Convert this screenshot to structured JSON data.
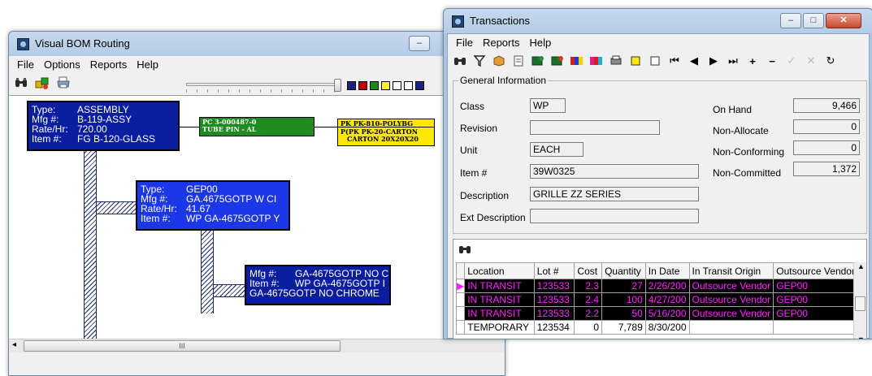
{
  "bom": {
    "title": "Visual BOM Routing",
    "menu": [
      "File",
      "Options",
      "Reports",
      "Help"
    ],
    "caption_min": "–",
    "toolbar_icons": [
      "binoculars-icon",
      "puzzle-icon",
      "printer-icon"
    ],
    "swatch_colors": [
      "#1a237e",
      "#c00000",
      "#1b8a1b",
      "#ffef33",
      "#ffffff",
      "#ffffff",
      "#1a237e"
    ],
    "nodes": {
      "assembly": {
        "color": "#0b1ea0",
        "rows": [
          {
            "k": "Type:",
            "v": "ASSEMBLY"
          },
          {
            "k": "Mfg #:",
            "v": "B-119-ASSY"
          },
          {
            "k": "Rate/Hr:",
            "v": "720.00"
          },
          {
            "k": "Item #:",
            "v": "FG B-120-GLASS"
          }
        ]
      },
      "gep": {
        "color": "#1c37e8",
        "rows": [
          {
            "k": "Type:",
            "v": "GEP00"
          },
          {
            "k": "Mfg #:",
            "v": "GA.4675GOTP W CI"
          },
          {
            "k": "Rate/Hr:",
            "v": "41.67"
          },
          {
            "k": "Item #:",
            "v": "WP GA-4675GOTP Y"
          }
        ]
      },
      "mfg": {
        "color": "#0b1ea0",
        "rows": [
          {
            "k": "Mfg #:",
            "v": "GA-4675GOTP NO C"
          },
          {
            "k": "Item #:",
            "v": "WP GA-4675GOTP I"
          }
        ],
        "extra": "GA-4675GOTP NO CHROME"
      },
      "green": {
        "color": "#1f8a1f",
        "line1": "PC 3-000487-0",
        "line2": "TUBE PIN - AL"
      },
      "yellow1": {
        "color": "#ffe800",
        "line1": "PK PK-810-POLYBG"
      },
      "yellow2": {
        "color": "#ffe800",
        "line1": "PK PK-20-CARTON",
        "line2": "CARTON 20X20X20",
        "prefix": "P("
      }
    },
    "scroll_grip": "III"
  },
  "tx": {
    "title": "Transactions",
    "menu": [
      "File",
      "Reports",
      "Help"
    ],
    "caption_min": "–",
    "caption_max": "□",
    "caption_close": "✕",
    "nav_glyphs": [
      "⏮",
      "◀",
      "▶",
      "⏭",
      "+",
      "−",
      "✓",
      "✕",
      "↻"
    ],
    "general_legend": "General Information",
    "fields": {
      "class_label": "Class",
      "class_value": "WP",
      "revision_label": "Revision",
      "revision_value": "",
      "unit_label": "Unit",
      "unit_value": "EACH",
      "item_label": "Item #",
      "item_value": "39W0325",
      "desc_label": "Description",
      "desc_value": "GRILLE ZZ SERIES",
      "extdesc_label": "Ext Description",
      "extdesc_value": "",
      "onhand_label": "On Hand",
      "onhand_value": "9,466",
      "nonalloc_label": "Non-Allocate",
      "nonalloc_value": "0",
      "nonconf_label": "Non-Conforming",
      "nonconf_value": "0",
      "noncomm_label": "Non-Committed",
      "noncomm_value": "1,372"
    },
    "grid": {
      "headers": [
        "Location",
        "Lot #",
        "Cost",
        "Quantity",
        "In Date",
        "In Transit Origin",
        "Outsource Vendor #"
      ],
      "rows": [
        {
          "transit": true,
          "cells": [
            "IN TRANSIT",
            "123533",
            "2.3",
            "27",
            "2/26/200",
            "Outsource Vendor",
            "GEP00"
          ]
        },
        {
          "transit": true,
          "cells": [
            "IN TRANSIT",
            "123533",
            "2.4",
            "100",
            "4/27/200",
            "Outsource Vendor",
            "GEP00"
          ]
        },
        {
          "transit": true,
          "cells": [
            "IN TRANSIT",
            "123533",
            "2.2",
            "50",
            "5/16/200",
            "Outsource Vendor",
            "GEP00"
          ]
        },
        {
          "transit": false,
          "cells": [
            "TEMPORARY",
            "123534",
            "0",
            "7,789",
            "8/30/200",
            "",
            ""
          ]
        }
      ]
    }
  }
}
